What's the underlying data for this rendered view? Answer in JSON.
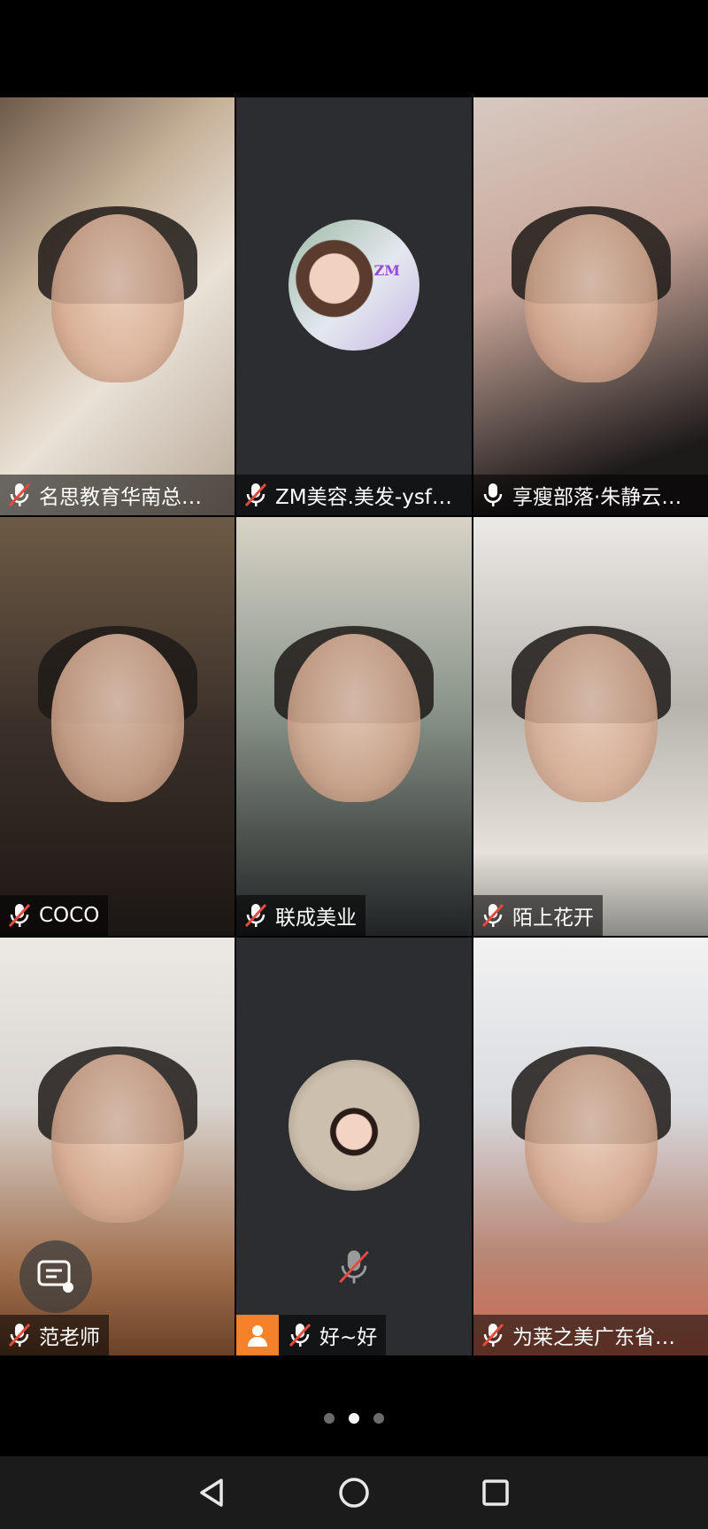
{
  "participants": [
    {
      "name": "名思教育华南总…",
      "mic": "muted"
    },
    {
      "name": "ZM美容.美发-ysf…",
      "mic": "muted",
      "avatar_text": "ZM"
    },
    {
      "name": "享瘦部落·朱静云…",
      "mic": "on"
    },
    {
      "name": "COCO",
      "mic": "muted"
    },
    {
      "name": "联成美业",
      "mic": "muted"
    },
    {
      "name": "陌上花开",
      "mic": "muted"
    },
    {
      "name": "范老师",
      "mic": "muted"
    },
    {
      "name": "好~好",
      "mic": "muted"
    },
    {
      "name": "为莱之美广东省…",
      "mic": "muted"
    }
  ],
  "pagination": {
    "pages": 3,
    "current": 2
  },
  "colors": {
    "active_speaker_border": "#35c67a",
    "host_badge": "#f5822a",
    "muted_slash": "#e64a3c"
  },
  "icons": {
    "muted": "mic-muted-icon",
    "unmuted": "mic-icon",
    "chat": "chat-bubble-icon",
    "host": "person-icon",
    "nav": [
      "back-triangle-icon",
      "home-circle-icon",
      "recents-square-icon"
    ]
  }
}
